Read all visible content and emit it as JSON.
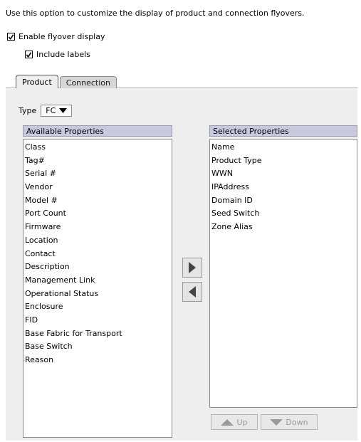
{
  "description": "Use this option to customize the display of product and connection flyovers.",
  "enable_flyover": {
    "label": "Enable flyover display",
    "checked": true
  },
  "include_labels": {
    "label": "Include labels",
    "checked": true
  },
  "tabs": [
    {
      "label": "Product",
      "active": true
    },
    {
      "label": "Connection",
      "active": false
    }
  ],
  "type": {
    "label": "Type",
    "value": "FC"
  },
  "available": {
    "header": "Available Properties",
    "items": [
      "Class",
      "Tag#",
      "Serial #",
      "Vendor",
      "Model #",
      "Port Count",
      "Firmware",
      "Location",
      "Contact",
      "Description",
      "Management Link",
      "Operational Status",
      "Enclosure",
      "FID",
      "Base Fabric for Transport",
      "Base Switch",
      "Reason"
    ]
  },
  "selected": {
    "header": "Selected Properties",
    "items": [
      "Name",
      "Product Type",
      "WWN",
      "IPAddress",
      "Domain ID",
      "Seed Switch",
      "Zone Alias"
    ]
  },
  "buttons": {
    "up": "Up",
    "down": "Down",
    "add_icon": "arrow-right-icon",
    "remove_icon": "arrow-left-icon"
  }
}
